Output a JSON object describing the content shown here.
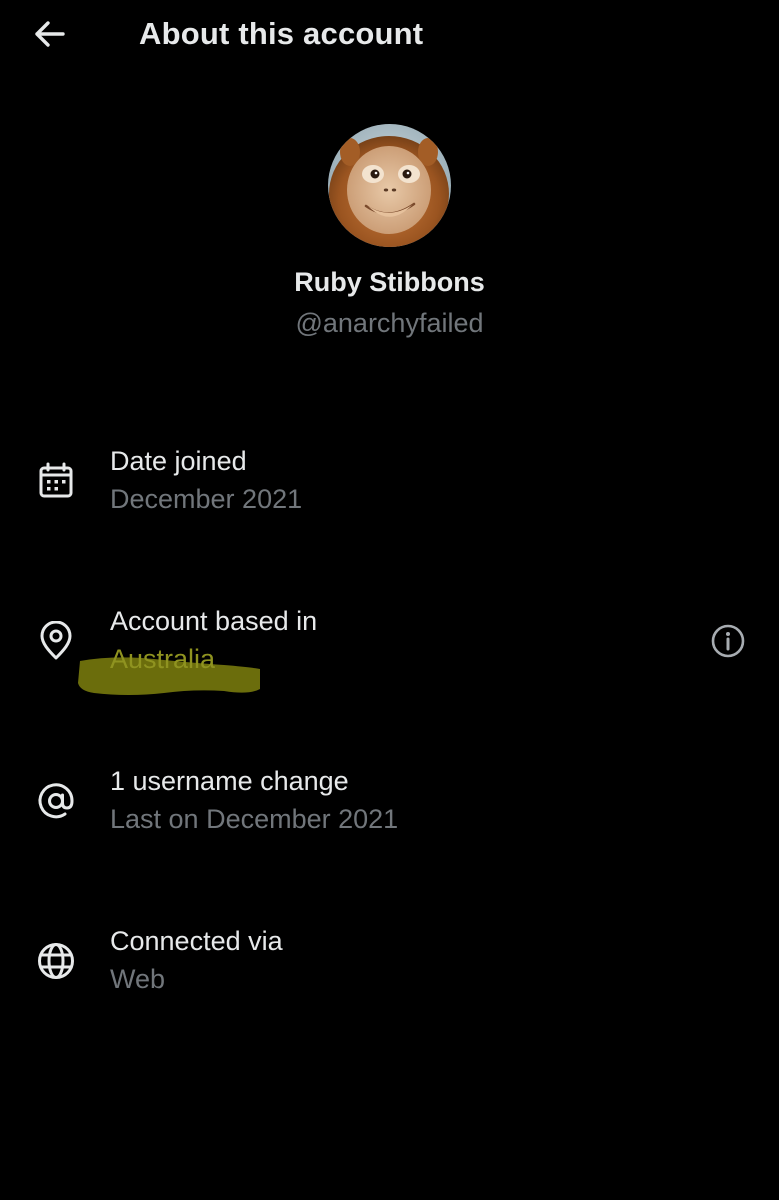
{
  "header": {
    "back_icon": "arrow-left-icon",
    "title": "About this account"
  },
  "profile": {
    "name": "Ruby Stibbons",
    "handle": "@anarchyfailed",
    "avatar_icon": "orangutan-avatar"
  },
  "details": [
    {
      "icon": "calendar-icon",
      "label": "Date joined",
      "value": "December 2021"
    },
    {
      "icon": "location-pin-icon",
      "label": "Account based in",
      "value": "Australia",
      "highlight_color": "#8f9320",
      "info_icon": "info-icon"
    },
    {
      "icon": "at-sign-icon",
      "label": "1 username change",
      "value": "Last on December 2021"
    },
    {
      "icon": "globe-icon",
      "label": "Connected via",
      "value": "Web"
    }
  ],
  "colors": {
    "background": "#000000",
    "primary_text": "#e7e9ea",
    "secondary_text": "#71767b",
    "highlighter": "#6b6d0c"
  }
}
